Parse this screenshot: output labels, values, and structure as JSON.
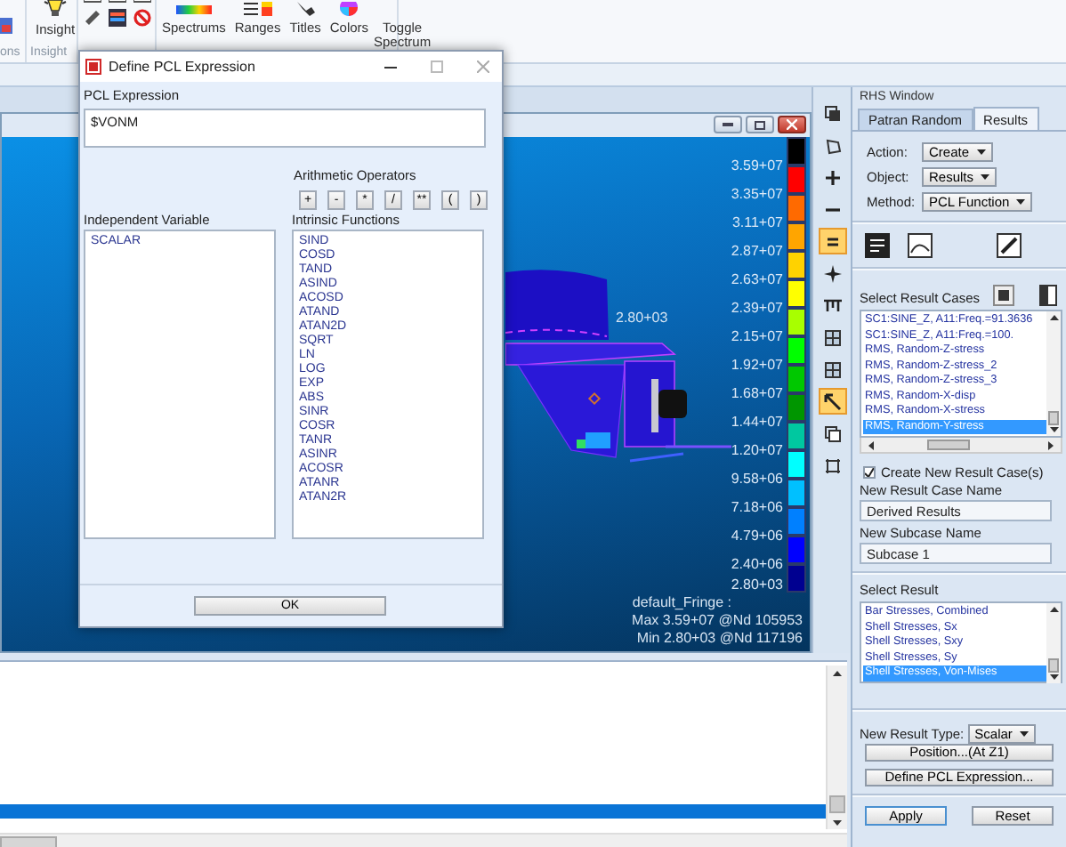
{
  "ribbon": {
    "first_group_label": "ons",
    "insight_button": "Insight",
    "insight_group_label": "Insight",
    "fringe_buttons": [
      "Spectrums",
      "Ranges",
      "Titles",
      "Colors",
      "Toggle Spectrum"
    ]
  },
  "dialog": {
    "title": "Define PCL Expression",
    "expression_label": "PCL Expression",
    "expression": "$VONM",
    "operators_label": "Arithmetic Operators",
    "operators": [
      "+",
      "-",
      "*",
      "/",
      "**",
      "(",
      ")"
    ],
    "variable_label": "Independent Variable",
    "variables": [
      "SCALAR"
    ],
    "functions_label": "Intrinsic Functions",
    "functions": [
      "SIND",
      "COSD",
      "TAND",
      "ASIND",
      "ACOSD",
      "ATAND",
      "ATAN2D",
      "SQRT",
      "LN",
      "LOG",
      "EXP",
      "ABS",
      "SINR",
      "COSR",
      "TANR",
      "ASINR",
      "ACOSR",
      "ATANR",
      "ATAN2R"
    ],
    "ok": "OK"
  },
  "viewport": {
    "legend": [
      {
        "color": "#000000"
      },
      {
        "color": "#ff0000"
      },
      {
        "color": "#ff6a00"
      },
      {
        "color": "#ffa500"
      },
      {
        "color": "#ffd200"
      },
      {
        "color": "#ffff00"
      },
      {
        "color": "#a8ff00"
      },
      {
        "color": "#00ff00"
      },
      {
        "color": "#00c800"
      },
      {
        "color": "#009600"
      },
      {
        "color": "#00c8a0"
      },
      {
        "color": "#00ffff"
      },
      {
        "color": "#00c0ff"
      },
      {
        "color": "#0080ff"
      },
      {
        "color": "#0000ff"
      },
      {
        "color": "#000090"
      }
    ],
    "legend_labels": [
      "3.59+07",
      "3.35+07",
      "3.11+07",
      "2.87+07",
      "2.63+07",
      "2.39+07",
      "2.15+07",
      "1.92+07",
      "1.68+07",
      "1.44+07",
      "1.20+07",
      "9.58+06",
      "7.18+06",
      "4.79+06",
      "2.40+06",
      "2.80+03"
    ],
    "node_label": "2.80+03",
    "fringe_title": "default_Fringe :",
    "max": "Max 3.59+07 @Nd 105953",
    "min": "Min 2.80+03 @Nd 117196"
  },
  "tool_strip": [
    {
      "selected": false
    },
    {
      "selected": false
    },
    {
      "selected": false
    },
    {
      "selected": false
    },
    {
      "selected": true
    },
    {
      "selected": false
    },
    {
      "selected": false
    },
    {
      "selected": false
    },
    {
      "selected": false
    },
    {
      "selected": true
    },
    {
      "selected": false
    },
    {
      "selected": false
    }
  ],
  "bottom_list": {
    "rows": [
      {
        "selected": false
      },
      {
        "selected": false
      },
      {
        "selected": false
      },
      {
        "selected": false
      },
      {
        "selected": false
      },
      {
        "selected": false
      },
      {
        "selected": false
      },
      {
        "selected": false
      },
      {
        "selected": false
      },
      {
        "selected": false
      },
      {
        "selected": true
      },
      {
        "selected": false
      }
    ]
  },
  "rhs": {
    "title": "RHS Window",
    "tabs": [
      {
        "label": "Patran Random",
        "selected": false
      },
      {
        "label": "Results",
        "selected": true
      }
    ],
    "fields": [
      {
        "label": "Action:",
        "value": "Create"
      },
      {
        "label": "Object:",
        "value": "Results"
      },
      {
        "label": "Method:",
        "value": "PCL Function"
      }
    ],
    "result_cases_label": "Select Result Cases",
    "result_cases": [
      {
        "label": "SC1:SINE_Z, A11:Freq.=91.3636",
        "selected": false
      },
      {
        "label": "SC1:SINE_Z, A11:Freq.=100.",
        "selected": false
      },
      {
        "label": "RMS, Random-Z-stress",
        "selected": false
      },
      {
        "label": "RMS, Random-Z-stress_2",
        "selected": false
      },
      {
        "label": "RMS, Random-Z-stress_3",
        "selected": false
      },
      {
        "label": "RMS, Random-X-disp",
        "selected": false
      },
      {
        "label": "RMS, Random-X-stress",
        "selected": false
      },
      {
        "label": "RMS, Random-Y-stress",
        "selected": true
      }
    ],
    "create_new": {
      "label": "Create New Result Case(s)",
      "checked": true
    },
    "case_name_label": "New Result Case Name",
    "case_name": "Derived Results",
    "subcase_label": "New Subcase Name",
    "subcase": "Subcase 1",
    "select_result_label": "Select Result",
    "results": [
      {
        "label": "Bar Stresses, Combined",
        "selected": false
      },
      {
        "label": "Shell Stresses, Sx",
        "selected": false
      },
      {
        "label": "Shell Stresses, Sxy",
        "selected": false
      },
      {
        "label": "Shell Stresses, Sy",
        "selected": false
      },
      {
        "label": "Shell Stresses, Von-Mises",
        "selected": true
      }
    ],
    "result_type_label": "New Result Type:",
    "result_type": "Scalar",
    "position_button": "Position...(At Z1)",
    "define_button": "Define PCL Expression...",
    "apply": "Apply",
    "reset": "Reset"
  }
}
